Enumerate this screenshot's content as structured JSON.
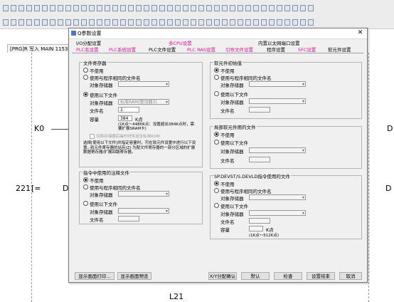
{
  "background": {
    "doc_tab": "[PRG]R 写入 MAIN 1153步",
    "ladder": {
      "k0": "K0",
      "row_number": "221",
      "bracket": "[=",
      "d_left": "D",
      "d_right_top": "D",
      "d_right_mid": "D",
      "l21": "L21"
    }
  },
  "dialog": {
    "title": "Q参数设置",
    "close_glyph": "✕",
    "tabs_row1": [
      {
        "label": "I/O分配设置",
        "pink": false
      },
      {
        "label": "多CPU设置",
        "pink": true
      },
      {
        "label": "内置以太网端口设置",
        "pink": false
      }
    ],
    "tabs_row2": [
      {
        "label": "PLC名设置",
        "pink": true
      },
      {
        "label": "PLC系统设置",
        "pink": true
      },
      {
        "label": "PLC文件设置",
        "pink": false
      },
      {
        "label": "PLC RAS设置",
        "pink": true
      },
      {
        "label": "引导文件设置",
        "pink": true
      },
      {
        "label": "程序设置",
        "pink": false
      },
      {
        "label": "SFC设置",
        "pink": true
      },
      {
        "label": "软元件设置",
        "pink": false
      }
    ],
    "file_register": {
      "title": "文件寄存器",
      "not_used": "不使用",
      "same_name": "使用与程序相同的文件名",
      "target_memory_1": "对象存储器",
      "use_following": "使用以下文件",
      "target_memory_2": "对象存储器",
      "target_memory_value": "标准RAM(驱动器3)",
      "file_name_label": "文件名",
      "file_name_value": "1",
      "capacity_label": "容量",
      "capacity_value": "384",
      "capacity_unit": "K点",
      "capacity_note": "(1K点～4480K点：设置超出384K点时，需要扩展SRAM卡)",
      "transfer_check": "切换存储器后操作时传送至标准ROM",
      "explanation": "选择[使用以下文件]并指定容量时，可在软元件设置中进行以下设置。·软元件寄存器的站存(Z)·为配文件寄存器的一部分区域的扩展数据寄存器/扩展回路寄存器。"
    },
    "comment_file": {
      "title": "指令中使用的注释文件",
      "not_used": "不使用",
      "same_name": "使用与程序相同的文件名",
      "target_memory_1": "对象存储器",
      "use_following": "使用以下文件",
      "target_memory_2": "对象存储器",
      "file_name_label": "文件名"
    },
    "device_init": {
      "title": "软元件初始值",
      "not_used": "不使用",
      "same_name": "使用与程序相同的文件名",
      "target_memory_1": "对象存储器",
      "use_following": "使用以下文件",
      "target_memory_2": "对象存储器",
      "file_name_label": "文件名"
    },
    "latch_file": {
      "title": "局部软元件用的文件",
      "not_used": "不使用",
      "use_following": "使用以下文件",
      "target_memory": "对象存储器",
      "file_name_label": "文件名"
    },
    "sp_devst": {
      "title": "SP.DEVST/S.DEVLD指令使用的文件",
      "not_used": "不使用",
      "same_name": "使用与程序相同的文件名",
      "target_memory_1": "对象存储器",
      "use_following": "使用以下文件",
      "target_memory_2": "对象存储器",
      "file_name_label": "文件名",
      "capacity_label": "容量",
      "capacity_unit": "K点",
      "capacity_note": "(1K点～512K点)"
    },
    "buttons": {
      "print_window": "显示画面打印...",
      "preview": "显示画面预览",
      "xy_confirm": "X/Y分配确认",
      "default": "默认",
      "check": "检查",
      "end_setting": "设置结束",
      "cancel": "取消"
    }
  }
}
